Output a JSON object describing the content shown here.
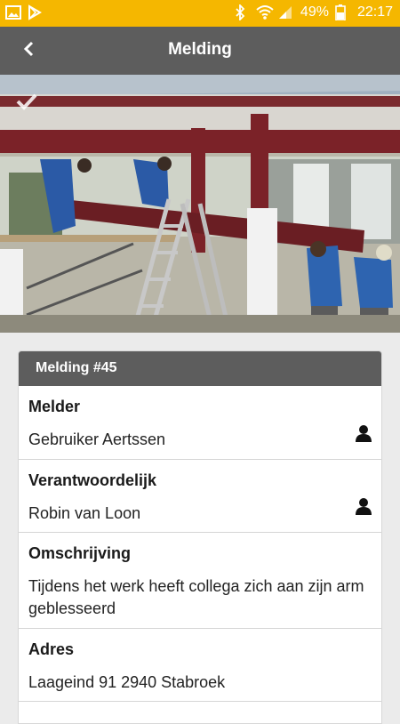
{
  "status_bar": {
    "battery_percent": "49%",
    "time": "22:17",
    "icons": [
      "image-icon",
      "play-store-icon",
      "bluetooth-icon",
      "wifi-icon",
      "signal-icon",
      "battery-icon"
    ]
  },
  "app_bar": {
    "title": "Melding",
    "back_icon": "back-arrow-icon"
  },
  "photo": {
    "badge_icon": "check-icon"
  },
  "card": {
    "header": "Melding #45",
    "sections": {
      "melder": {
        "label": "Melder",
        "value": "Gebruiker Aertssen",
        "icon": "person-icon"
      },
      "verantwoordelijk": {
        "label": "Verantwoordelijk",
        "value": "Robin van Loon",
        "icon": "person-icon"
      },
      "omschrijving": {
        "label": "Omschrijving",
        "value": "Tijdens het werk heeft collega zich aan zijn arm geblesseerd"
      },
      "adres": {
        "label": "Adres",
        "value": "Laageind 91 2940 Stabroek"
      }
    }
  },
  "colors": {
    "status_bar": "#f5b700",
    "app_bar": "#5d5d5d",
    "background": "#ebebeb"
  }
}
